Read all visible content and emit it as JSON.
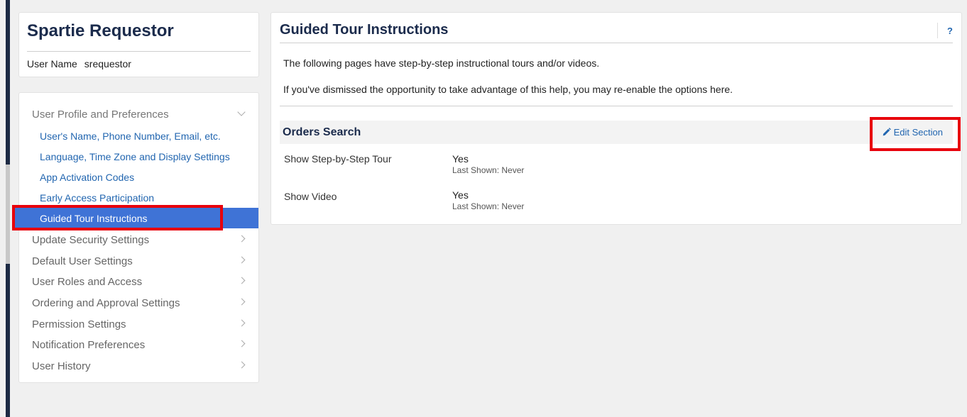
{
  "profile": {
    "name": "Spartie Requestor",
    "user_label": "User Name",
    "user_value": "srequestor"
  },
  "nav": {
    "section_header": "User Profile and Preferences",
    "sub_items": [
      {
        "label": "User's Name, Phone Number, Email, etc."
      },
      {
        "label": "Language, Time Zone and Display Settings"
      },
      {
        "label": "App Activation Codes"
      },
      {
        "label": "Early Access Participation"
      },
      {
        "label": "Guided Tour Instructions",
        "active": true
      }
    ],
    "items": [
      {
        "label": "Update Security Settings"
      },
      {
        "label": "Default User Settings"
      },
      {
        "label": "User Roles and Access"
      },
      {
        "label": "Ordering and Approval Settings"
      },
      {
        "label": "Permission Settings"
      },
      {
        "label": "Notification Preferences"
      },
      {
        "label": "User History"
      }
    ]
  },
  "main": {
    "title": "Guided Tour Instructions",
    "help": "?",
    "intro1": "The following pages have step-by-step instructional tours and/or videos.",
    "intro2": "If you've dismissed the opportunity to take advantage of this help, you may re-enable the options here.",
    "section": {
      "title": "Orders Search",
      "edit_label": "Edit Section",
      "rows": [
        {
          "label": "Show Step-by-Step Tour",
          "value": "Yes",
          "sub": "Last Shown: Never"
        },
        {
          "label": "Show Video",
          "value": "Yes",
          "sub": "Last Shown: Never"
        }
      ]
    }
  },
  "colors": {
    "accent": "#3f73d6",
    "link": "#2266b0",
    "title": "#1b2b4c",
    "highlight": "#e8000b"
  }
}
